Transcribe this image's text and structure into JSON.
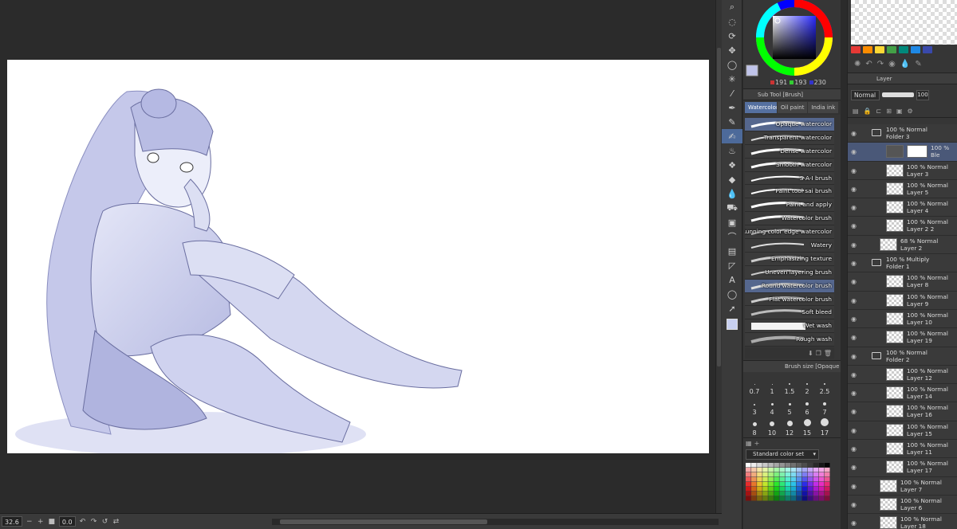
{
  "app": {
    "background": "#2b2b2b"
  },
  "status": {
    "zoom": "32.6",
    "rotation": "0.0"
  },
  "toolbar": {
    "tools": [
      "zoom-icon",
      "hand-icon",
      "rotate-icon",
      "move-icon",
      "lasso-icon",
      "magic-wand-icon",
      "eyedropper-icon",
      "pen-icon",
      "pencil-icon",
      "brush-icon",
      "airbrush-icon",
      "decoration-icon",
      "eraser-icon",
      "blend-icon",
      "fill-icon",
      "gradient-icon",
      "figure-icon",
      "frame-icon",
      "ruler-icon",
      "text-icon",
      "balloon-icon",
      "correction-icon"
    ],
    "active_tool": "brush-icon"
  },
  "color": {
    "r": "191",
    "g": "193",
    "b": "230",
    "main_color": "#bfc1e6"
  },
  "subtool": {
    "title": "Sub Tool [Brush]",
    "tabs": [
      "Watercolor",
      "Oil paint",
      "India ink"
    ],
    "active_tab": 0,
    "brushes": [
      "Opaque watercolor",
      "Transparent watercolor",
      "Dense watercolor",
      "Smooth watercolor",
      "S-A-I brush",
      "Paint tool sai brush",
      "Paint and apply",
      "Watercolor brush",
      "Running color edge watercolor",
      "Watery",
      "Emphasizing texture",
      "Uneven layering brush",
      "Round watercolor brush",
      "Flat watercolor brush",
      "Soft bleed",
      "Wet wash",
      "Rough wash"
    ],
    "selected": [
      "Opaque watercolor",
      "Round watercolor brush"
    ]
  },
  "brush_size": {
    "title": "Brush size [Opaque watercolor]",
    "sizes": [
      "0.7",
      "1",
      "1.5",
      "2",
      "2.5",
      "3",
      "4",
      "5",
      "6",
      "7",
      "8",
      "10",
      "12",
      "15",
      "17"
    ]
  },
  "color_set": {
    "title": "Standard color set"
  },
  "layers": {
    "title": "Layer",
    "blend_mode": "Normal",
    "opacity": "100",
    "rows": [
      {
        "line1": "100 % Normal",
        "line2": "Folder 3",
        "type": "folder",
        "indent": 0
      },
      {
        "line1": "100 %",
        "line2": "Ble",
        "type": "mask",
        "indent": 1
      },
      {
        "line1": "100 % Normal",
        "line2": "Layer 3",
        "type": "layer",
        "indent": 1
      },
      {
        "line1": "100 % Normal",
        "line2": "Layer 5",
        "type": "layer",
        "indent": 1
      },
      {
        "line1": "100 % Normal",
        "line2": "Layer 4",
        "type": "layer",
        "indent": 1
      },
      {
        "line1": "100 % Normal",
        "line2": "Layer 2 2",
        "type": "layer",
        "indent": 1
      },
      {
        "line1": "68 % Normal",
        "line2": "Layer 2",
        "type": "layer",
        "indent": 0
      },
      {
        "line1": "100 % Multiply",
        "line2": "Folder 1",
        "type": "folder",
        "indent": 0
      },
      {
        "line1": "100 % Normal",
        "line2": "Layer 8",
        "type": "layer",
        "indent": 1
      },
      {
        "line1": "100 % Normal",
        "line2": "Layer 9",
        "type": "layer",
        "indent": 1
      },
      {
        "line1": "100 % Normal",
        "line2": "Layer 10",
        "type": "layer",
        "indent": 1
      },
      {
        "line1": "100 % Normal",
        "line2": "Layer 19",
        "type": "layer",
        "indent": 1
      },
      {
        "line1": "100 % Normal",
        "line2": "Folder 2",
        "type": "folder",
        "indent": 0
      },
      {
        "line1": "100 % Normal",
        "line2": "Layer 12",
        "type": "layer",
        "indent": 1
      },
      {
        "line1": "100 % Normal",
        "line2": "Layer 14",
        "type": "layer",
        "indent": 1
      },
      {
        "line1": "100 % Normal",
        "line2": "Layer 16",
        "type": "layer",
        "indent": 1
      },
      {
        "line1": "100 % Normal",
        "line2": "Layer 15",
        "type": "layer",
        "indent": 1
      },
      {
        "line1": "100 % Normal",
        "line2": "Layer 11",
        "type": "layer",
        "indent": 1
      },
      {
        "line1": "100 % Normal",
        "line2": "Layer 17",
        "type": "layer",
        "indent": 1
      },
      {
        "line1": "100 % Normal",
        "line2": "Layer 7",
        "type": "layer",
        "indent": 0
      },
      {
        "line1": "100 % Normal",
        "line2": "Layer 6",
        "type": "layer",
        "indent": 0
      },
      {
        "line1": "100 % Normal",
        "line2": "Layer 18",
        "type": "layer",
        "indent": 0
      }
    ]
  }
}
